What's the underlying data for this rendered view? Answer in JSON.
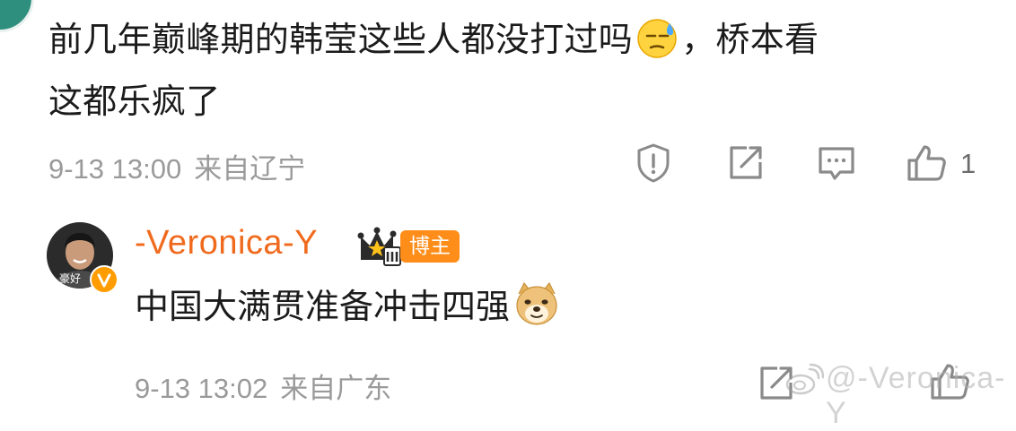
{
  "comments": [
    {
      "text_a": "前几年巅峰期的韩莹这些人都没打过吗",
      "emoji_1": "sweat-face",
      "text_b": "，桥本看",
      "text_c": "这都乐疯了",
      "time": "9-13 13:00",
      "location": "来自辽宁",
      "like_count": "1"
    },
    {
      "username": "-Veronica-Y",
      "role_badge": "博主",
      "avatar_caption": "豪好",
      "text": "中国大满贯准备冲击四强",
      "emoji_1": "doge",
      "time": "9-13 13:02",
      "location": "来自广东"
    }
  ],
  "watermark": "@-Veronica-Y",
  "colors": {
    "username": "#f06a1d",
    "badge": "#ff8d1a",
    "meta": "#9a9a9a",
    "icon": "#8a8a8a"
  }
}
